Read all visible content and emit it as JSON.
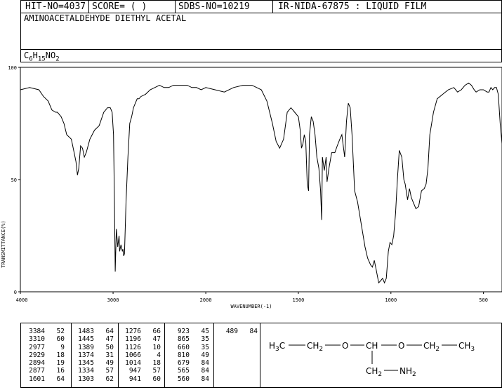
{
  "header": {
    "hit_no": "HIT-NO=4037",
    "score": "SCORE=  (   )",
    "sdbs_no": "SDBS-NO=10219",
    "method": "IR-NIDA-67875 : LIQUID FILM",
    "compound_name": "AMINOACETALDEHYDE DIETHYL ACETAL",
    "formula": "C6H15NO2"
  },
  "chart_data": {
    "type": "line",
    "title": "",
    "xlabel": "WAVENUMBER(-1)",
    "ylabel": "TRANSMITTANCE(%)",
    "xlim": [
      4000,
      400
    ],
    "ylim": [
      0,
      100
    ],
    "x_ticks": [
      4000,
      3000,
      2000,
      1500,
      1000,
      500
    ],
    "y_ticks": [
      0,
      50,
      100
    ],
    "series": [
      {
        "x": [
          4000,
          3900,
          3800,
          3750,
          3700,
          3660,
          3620,
          3600,
          3560,
          3530,
          3500,
          3450,
          3420,
          3400,
          3384,
          3370,
          3350,
          3330,
          3310,
          3290,
          3250,
          3200,
          3150,
          3100,
          3060,
          3030,
          3010,
          2995,
          2985,
          2977,
          2965,
          2950,
          2935,
          2929,
          2915,
          2900,
          2894,
          2885,
          2877,
          2860,
          2840,
          2820,
          2800,
          2780,
          2760,
          2740,
          2720,
          2700,
          2650,
          2600,
          2550,
          2500,
          2450,
          2400,
          2350,
          2300,
          2250,
          2200,
          2150,
          2100,
          2050,
          2000,
          1950,
          1900,
          1850,
          1800,
          1750,
          1700,
          1670,
          1640,
          1620,
          1601,
          1580,
          1560,
          1540,
          1520,
          1500,
          1490,
          1483,
          1475,
          1468,
          1460,
          1452,
          1445,
          1440,
          1430,
          1420,
          1410,
          1400,
          1389,
          1380,
          1374,
          1370,
          1360,
          1350,
          1345,
          1335,
          1320,
          1303,
          1290,
          1276,
          1265,
          1250,
          1240,
          1230,
          1220,
          1210,
          1196,
          1180,
          1160,
          1140,
          1126,
          1110,
          1100,
          1090,
          1080,
          1066,
          1055,
          1045,
          1035,
          1025,
          1014,
          1005,
          995,
          985,
          975,
          965,
          955,
          941,
          930,
          923,
          910,
          900,
          890,
          880,
          865,
          850,
          835,
          820,
          810,
          800,
          790,
          770,
          750,
          720,
          690,
          660,
          640,
          620,
          600,
          580,
          565,
          550,
          540,
          520,
          500,
          480,
          470,
          460,
          450,
          440,
          430,
          420,
          410,
          400
        ],
        "y": [
          90,
          91,
          90,
          87,
          85,
          81,
          80,
          80,
          78,
          75,
          70,
          68,
          62,
          58,
          52,
          55,
          65,
          64,
          60,
          62,
          68,
          72,
          74,
          80,
          82,
          82,
          80,
          70,
          40,
          9,
          28,
          20,
          25,
          18,
          21,
          18,
          19,
          16,
          17,
          40,
          60,
          75,
          78,
          82,
          84,
          86,
          86,
          87,
          88,
          90,
          91,
          92,
          91,
          91,
          92,
          92,
          92,
          92,
          91,
          91,
          90,
          91,
          90,
          89,
          91,
          92,
          92,
          90,
          85,
          75,
          67,
          64,
          68,
          80,
          82,
          80,
          78,
          72,
          64,
          66,
          70,
          67,
          48,
          45,
          70,
          78,
          76,
          70,
          60,
          55,
          45,
          32,
          60,
          54,
          60,
          49,
          55,
          62,
          62,
          65,
          68,
          70,
          60,
          76,
          84,
          82,
          70,
          45,
          40,
          30,
          20,
          15,
          12,
          11,
          14,
          10,
          4,
          5,
          6,
          4,
          6,
          18,
          22,
          21,
          25,
          35,
          50,
          63,
          60,
          50,
          48,
          41,
          46,
          42,
          40,
          37,
          38,
          45,
          46,
          48,
          55,
          70,
          80,
          86,
          88,
          90,
          91,
          89,
          90,
          92,
          93,
          92,
          90,
          89,
          90,
          90,
          89,
          89,
          91,
          90,
          91,
          91,
          88,
          75,
          66
        ]
      }
    ]
  },
  "peak_table": {
    "columns": [
      [
        [
          "3384",
          "52"
        ],
        [
          "3310",
          "60"
        ],
        [
          "2977",
          "9"
        ],
        [
          "2929",
          "18"
        ],
        [
          "2894",
          "19"
        ],
        [
          "2877",
          "16"
        ],
        [
          "1601",
          "64"
        ]
      ],
      [
        [
          "1483",
          "64"
        ],
        [
          "1445",
          "47"
        ],
        [
          "1389",
          "50"
        ],
        [
          "1374",
          "31"
        ],
        [
          "1345",
          "49"
        ],
        [
          "1334",
          "57"
        ],
        [
          "1303",
          "62"
        ]
      ],
      [
        [
          "1276",
          "66"
        ],
        [
          "1196",
          "47"
        ],
        [
          "1126",
          "10"
        ],
        [
          "1066",
          "4"
        ],
        [
          "1014",
          "18"
        ],
        [
          "947",
          "57"
        ],
        [
          "941",
          "60"
        ]
      ],
      [
        [
          "923",
          "45"
        ],
        [
          "865",
          "35"
        ],
        [
          "660",
          "35"
        ],
        [
          "810",
          "49"
        ],
        [
          "679",
          "84"
        ],
        [
          "565",
          "84"
        ],
        [
          "560",
          "84"
        ]
      ],
      [
        [
          "489",
          "84"
        ]
      ]
    ]
  },
  "structure": {
    "main_chain": "H3C—CH2—O—CH—O—CH2—CH3",
    "branch": "CH2—NH2"
  }
}
